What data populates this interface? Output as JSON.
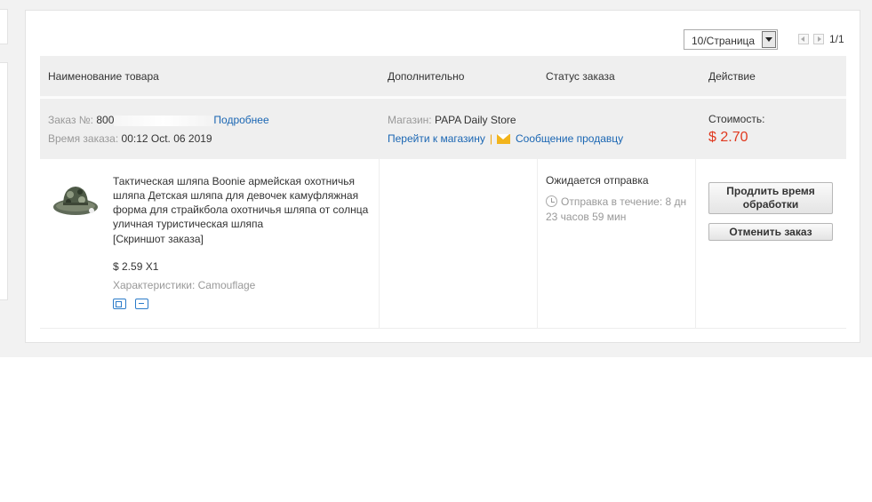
{
  "pagination": {
    "per_page": "10/Страница",
    "page_info": "1/1"
  },
  "table_header": {
    "product": "Наименование товара",
    "extra": "Дополнительно",
    "status": "Статус заказа",
    "action": "Действие"
  },
  "order": {
    "number_label": "Заказ №:",
    "number_value": "800",
    "details_link": "Подробнее",
    "time_label": "Время заказа:",
    "time_value": "00:12 Oct. 06 2019",
    "store_label": "Магазин:",
    "store_name": "PAPA Daily Store",
    "go_to_store": "Перейти к магазину",
    "separator": "|",
    "message_seller": "Сообщение продавцу",
    "cost_label": "Стоимость:",
    "cost_value": "$ 2.70"
  },
  "item": {
    "title": "Тактическая шляпа Boonie армейская охотничья шляпа Детская шляпа для девочек камуфляжная форма для страйкбола охотничья шляпа от солнца уличная туристическая шляпа",
    "snapshot": "[Скриншот заказа]",
    "unit_price": "$ 2.59 X1",
    "properties": "Характеристики: Camouflage",
    "icons": [
      "shipping-icon",
      "return-icon"
    ]
  },
  "status": {
    "text": "Ожидается отправка",
    "shipping": "Отправка в течение: 8 дн 23 часов 59 мин"
  },
  "actions": {
    "extend": "Продлить время обработки",
    "cancel": "Отменить заказ"
  },
  "colors": {
    "link": "#1a66b3",
    "price": "#e0391f",
    "header_bg": "#efefef",
    "page_bg": "#f2f2f2"
  }
}
